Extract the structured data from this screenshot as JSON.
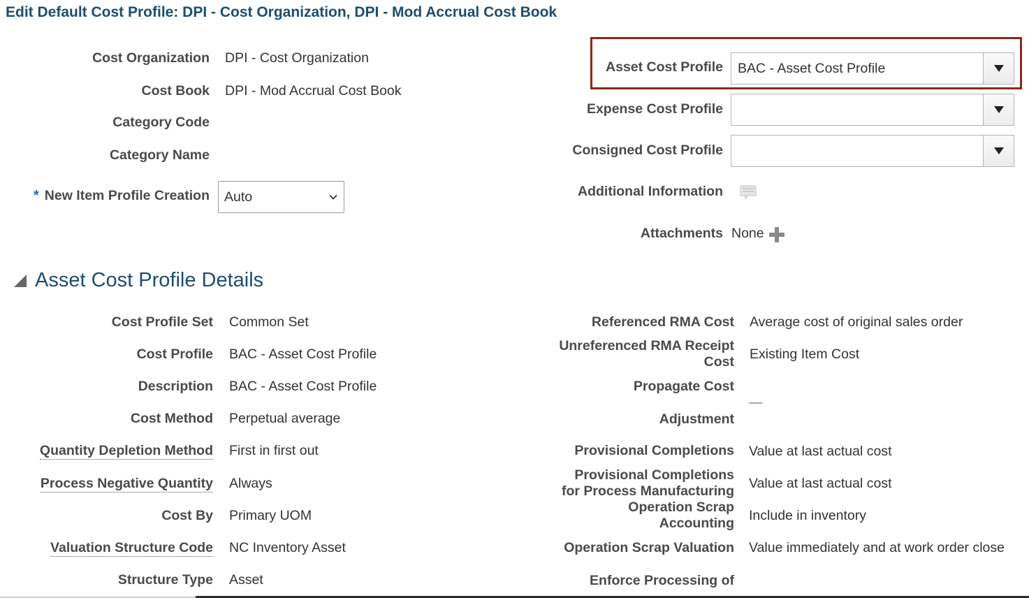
{
  "page_title": "Edit Default Cost Profile: DPI - Cost Organization, DPI - Mod Accrual Cost Book",
  "header_left": {
    "cost_organization": {
      "label": "Cost Organization",
      "value": "DPI - Cost Organization"
    },
    "cost_book": {
      "label": "Cost Book",
      "value": "DPI - Mod Accrual Cost Book"
    },
    "category_code": {
      "label": "Category Code",
      "value": ""
    },
    "category_name": {
      "label": "Category Name",
      "value": ""
    },
    "new_item_profile_creation": {
      "required_mark": "*",
      "label": "New Item Profile Creation",
      "value": "Auto"
    }
  },
  "header_right": {
    "asset_cost_profile": {
      "label": "Asset Cost Profile",
      "value": "BAC - Asset Cost Profile"
    },
    "expense_cost_profile": {
      "label": "Expense Cost Profile",
      "value": ""
    },
    "consigned_cost_profile": {
      "label": "Consigned Cost Profile",
      "value": ""
    },
    "additional_information": {
      "label": "Additional Information"
    },
    "attachments": {
      "label": "Attachments",
      "value": "None"
    }
  },
  "details": {
    "section_title": "Asset Cost Profile Details",
    "left": [
      {
        "label": "Cost Profile Set",
        "value": "Common Set",
        "dotted": false
      },
      {
        "label": "Cost Profile",
        "value": "BAC - Asset Cost Profile",
        "dotted": false
      },
      {
        "label": "Description",
        "value": "BAC - Asset Cost Profile",
        "dotted": false
      },
      {
        "label": "Cost Method",
        "value": "Perpetual average",
        "dotted": false
      },
      {
        "label": "Quantity Depletion Method",
        "value": "First in first out",
        "dotted": true
      },
      {
        "label": "Process Negative Quantity",
        "value": "Always",
        "dotted": true
      },
      {
        "label": "Cost By",
        "value": "Primary UOM",
        "dotted": false
      },
      {
        "label": "Valuation Structure Code",
        "value": "NC Inventory Asset",
        "dotted": true
      },
      {
        "label": "Structure Type",
        "value": "Asset",
        "dotted": false
      }
    ],
    "right": {
      "referenced_rma_cost": {
        "label": "Referenced RMA Cost",
        "value": "Average cost of original sales order"
      },
      "unreferenced_rma_receipt_cost": {
        "label_line1": "Unreferenced RMA Receipt",
        "label_line2": "Cost",
        "value": "Existing Item Cost"
      },
      "propagate_cost": {
        "label": "Propagate Cost",
        "value": ""
      },
      "adjustment": {
        "label": "Adjustment",
        "value": "—"
      },
      "provisional_completions": {
        "label": "Provisional Completions",
        "value": "Value at last actual cost"
      },
      "provisional_completions_pm": {
        "label_line1": "Provisional Completions",
        "label_line2": "for Process Manufacturing",
        "value": "Value at last actual cost"
      },
      "operation_scrap_accounting": {
        "label_line1": "Operation Scrap",
        "label_line2": "Accounting",
        "value": "Include in inventory"
      },
      "operation_scrap_valuation": {
        "label": "Operation Scrap Valuation",
        "value": "Value immediately and at work order close"
      },
      "enforce_processing_of": {
        "label": "Enforce Processing of"
      }
    }
  }
}
